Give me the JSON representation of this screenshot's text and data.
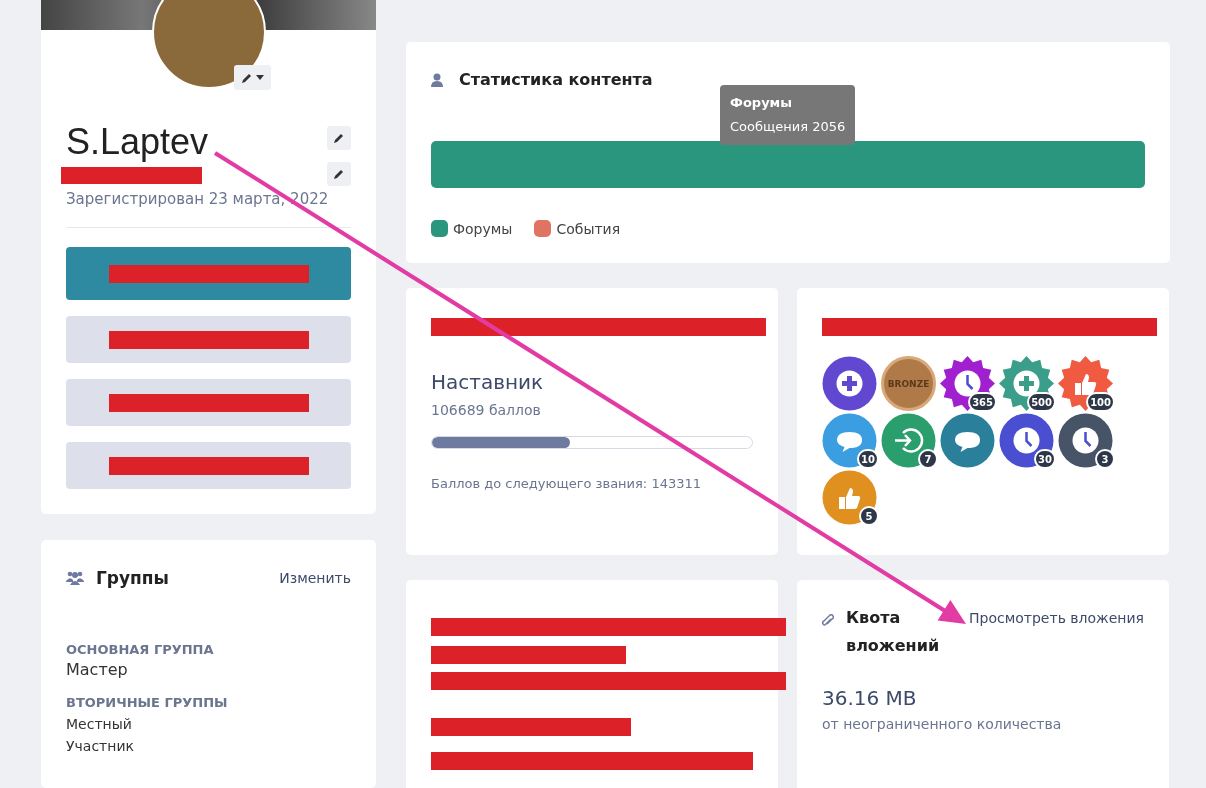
{
  "profile": {
    "name": "S.Laptev",
    "registered": "Зарегистрирован 23 марта, 2022",
    "menu": [
      {
        "selected": true
      },
      {
        "selected": false
      },
      {
        "selected": false
      },
      {
        "selected": false
      }
    ]
  },
  "groups": {
    "title": "Группы",
    "edit_link": "Изменить",
    "primary_label": "ОСНОВНАЯ ГРУППА",
    "primary": "Мастер",
    "secondary_label": "ВТОРИЧНЫЕ ГРУППЫ",
    "secondary": [
      "Местный",
      "Участник"
    ]
  },
  "content_stats": {
    "title": "Статистика контента",
    "tooltip": {
      "title": "Форумы",
      "text": "Сообщения 2056"
    },
    "legend": [
      {
        "label": "Форумы",
        "color": "#2a967e"
      },
      {
        "label": "События",
        "color": "#e07462"
      }
    ]
  },
  "rank": {
    "name": "Наставник",
    "points": "106689 баллов",
    "level": 0.43,
    "next": "Баллов до следующего звания: 143311"
  },
  "badges": [
    {
      "kind": "circle",
      "color": "#6248d0"
    },
    {
      "kind": "medal",
      "label": "BRONZE",
      "color": "#b07a48"
    },
    {
      "kind": "star",
      "color": "#a020d0",
      "count": "365"
    },
    {
      "kind": "star",
      "color": "#3a9e8a",
      "count": "500"
    },
    {
      "kind": "star",
      "color": "#f05a40",
      "count": "100"
    },
    {
      "kind": "circle",
      "color": "#3a9ee0",
      "count": "10"
    },
    {
      "kind": "circle",
      "color": "#2a9e6c",
      "count": "7"
    },
    {
      "kind": "circle",
      "color": "#2a7f9a"
    },
    {
      "kind": "circle",
      "color": "#4a4ed0",
      "count": "30"
    },
    {
      "kind": "circle",
      "color": "#475468",
      "count": "3"
    },
    {
      "kind": "circle",
      "color": "#e0901e",
      "count": "5"
    }
  ],
  "quota": {
    "title": "Квота вложений",
    "link": "Просмотреть вложения",
    "used": "36.16 MB",
    "of": "от неограниченного количества"
  }
}
